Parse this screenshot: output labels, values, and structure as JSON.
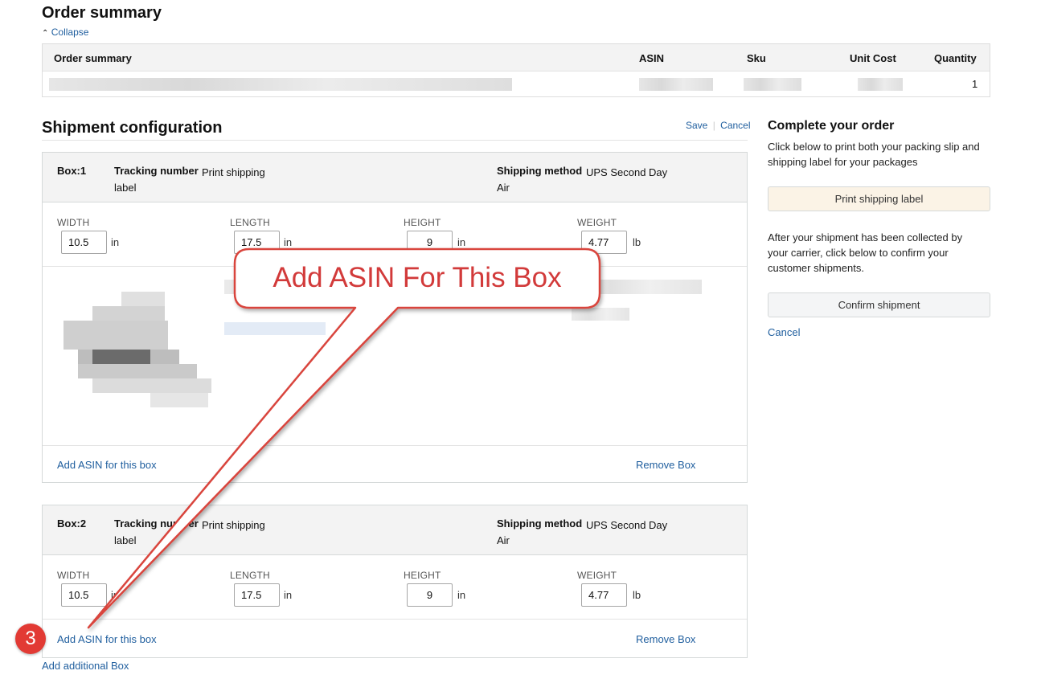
{
  "order_summary": {
    "title": "Order summary",
    "collapse_label": "Collapse",
    "columns": [
      "Order summary",
      "ASIN",
      "Sku",
      "Unit Cost",
      "Quantity"
    ],
    "row": {
      "quantity": "1"
    }
  },
  "shipment": {
    "title": "Shipment configuration",
    "save_label": "Save",
    "cancel_label": "Cancel",
    "tracking_label": "Tracking number",
    "tracking_value": "Print shipping label",
    "method_label": "Shipping method",
    "method_value": "UPS Second Day Air",
    "dim_labels": {
      "width": "WIDTH",
      "length": "LENGTH",
      "height": "HEIGHT",
      "weight": "WEIGHT"
    },
    "units": {
      "in": "in",
      "lb": "lb"
    },
    "add_asin_label": "Add ASIN for this box",
    "remove_box_label": "Remove Box",
    "add_box_label": "Add additional Box",
    "boxes": [
      {
        "label": "Box:1",
        "width": "10.5",
        "length": "17.5",
        "height": "9",
        "weight": "4.77"
      },
      {
        "label": "Box:2",
        "width": "10.5",
        "length": "17.5",
        "height": "9",
        "weight": "4.77"
      }
    ]
  },
  "complete": {
    "title": "Complete your order",
    "desc1": "Click below to print both your packing slip and shipping label for your packages",
    "print_label": "Print shipping label",
    "desc2": "After your shipment has been collected by your carrier, click below to confirm your customer shipments.",
    "confirm_label": "Confirm shipment",
    "cancel_label": "Cancel"
  },
  "annotation": {
    "callout_text": "Add ASIN For This Box",
    "step_number": "3"
  },
  "colors": {
    "link": "#1f5e9e",
    "annotation_red": "#d23a3a",
    "print_button_bg": "#fbf3e6",
    "confirm_button_bg": "#f4f5f6",
    "header_bg": "#f3f3f3"
  }
}
